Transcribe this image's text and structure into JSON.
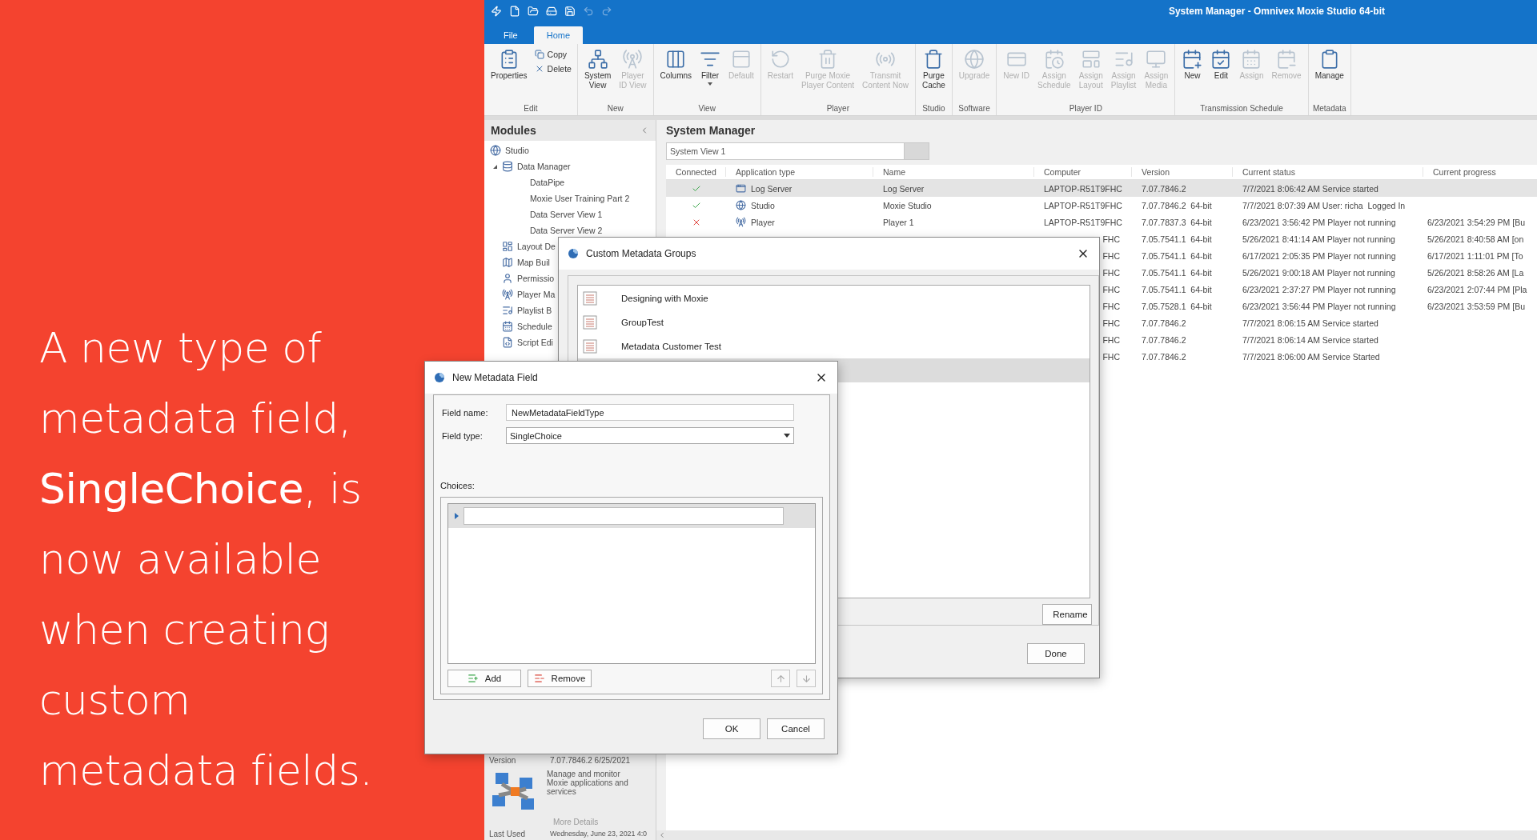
{
  "promo": {
    "text": "A new type of\nmetadata field,\n**SingleChoice**, is\nnow available\nwhen creating\ncustom\nmetadata fields."
  },
  "window": {
    "title": "System Manager - Omnivex Moxie Studio 64-bit"
  },
  "ribbon_tabs": [
    {
      "label": "File",
      "selected": false
    },
    {
      "label": "Home",
      "selected": true
    }
  ],
  "ribbon_groups": [
    {
      "label": "Edit",
      "buttons": [
        {
          "label": "Properties",
          "kind": "large",
          "disabled": false
        },
        {
          "label": "Copy",
          "kind": "small",
          "disabled": false
        },
        {
          "label": "Delete",
          "kind": "small",
          "disabled": false
        }
      ]
    },
    {
      "label": "New",
      "buttons": [
        {
          "label": "System\nView",
          "kind": "large",
          "disabled": false
        },
        {
          "label": "Player\nID View",
          "kind": "large",
          "disabled": true
        }
      ]
    },
    {
      "label": "View",
      "buttons": [
        {
          "label": "Columns",
          "kind": "large",
          "disabled": false
        },
        {
          "label": "Filter",
          "kind": "large",
          "disabled": false,
          "dropdown": true
        },
        {
          "label": "Default",
          "kind": "large",
          "disabled": true
        }
      ]
    },
    {
      "label": "Player",
      "buttons": [
        {
          "label": "Restart",
          "kind": "large",
          "disabled": true
        },
        {
          "label": "Purge Moxie\nPlayer Content",
          "kind": "large",
          "disabled": true
        },
        {
          "label": "Transmit\nContent Now",
          "kind": "large",
          "disabled": true
        }
      ]
    },
    {
      "label": "Studio",
      "buttons": [
        {
          "label": "Purge\nCache",
          "kind": "large",
          "disabled": false
        }
      ]
    },
    {
      "label": "Software",
      "buttons": [
        {
          "label": "Upgrade",
          "kind": "large",
          "disabled": true
        }
      ]
    },
    {
      "label": "Player ID",
      "buttons": [
        {
          "label": "New ID",
          "kind": "large",
          "disabled": true
        },
        {
          "label": "Assign\nSchedule",
          "kind": "large",
          "disabled": true
        },
        {
          "label": "Assign\nLayout",
          "kind": "large",
          "disabled": true
        },
        {
          "label": "Assign\nPlaylist",
          "kind": "large",
          "disabled": true
        },
        {
          "label": "Assign\nMedia",
          "kind": "large",
          "disabled": true
        }
      ]
    },
    {
      "label": "Transmission Schedule",
      "buttons": [
        {
          "label": "New",
          "kind": "large",
          "disabled": false
        },
        {
          "label": "Edit",
          "kind": "large",
          "disabled": false
        },
        {
          "label": "Assign",
          "kind": "large",
          "disabled": true
        },
        {
          "label": "Remove",
          "kind": "large",
          "disabled": true
        }
      ]
    },
    {
      "label": "Metadata",
      "buttons": [
        {
          "label": "Manage",
          "kind": "large",
          "disabled": false
        }
      ]
    }
  ],
  "modules": {
    "title": "Modules",
    "tree": [
      {
        "label": "Studio",
        "children": [
          {
            "label": "Data Manager",
            "expanded": true,
            "children": [
              {
                "label": "DataPipe"
              },
              {
                "label": "Moxie User Training Part 2"
              },
              {
                "label": "Data Server View 1"
              },
              {
                "label": "Data Server View 2"
              }
            ]
          },
          {
            "label": "Layout De"
          },
          {
            "label": "Map Buil"
          },
          {
            "label": "Permissio"
          },
          {
            "label": "Player Ma"
          },
          {
            "label": "Playlist B"
          },
          {
            "label": "Schedule"
          },
          {
            "label": "Script Edi"
          }
        ]
      }
    ],
    "details": {
      "version_label": "Version",
      "version": "7.07.7846.2 6/25/2021",
      "description": "Manage and monitor Moxie applications and services",
      "more_link": "More Details",
      "last_used_label": "Last Used",
      "last_used": "Wednesday, June 23, 2021 4:0"
    }
  },
  "main": {
    "title": "System Manager",
    "view_tabs": [
      {
        "label": "System View 1",
        "selected": true
      }
    ],
    "table": {
      "columns": [
        "Connected",
        "Application type",
        "Name",
        "Computer",
        "Version",
        "Current status",
        "Current progress"
      ],
      "rows": [
        {
          "kind": "full",
          "selected": true,
          "connected": true,
          "app_type": "Log Server",
          "name": "Log Server",
          "computer": "LAPTOP-R51T9FHC",
          "version": "7.07.7846.2",
          "status": "7/7/2021 8:06:42 AM Service started"
        },
        {
          "kind": "full",
          "selected": false,
          "connected": true,
          "app_type": "Studio",
          "name": "Moxie Studio",
          "computer": "LAPTOP-R51T9FHC",
          "version": "7.07.7846.2  64-bit",
          "status": "7/7/2021 8:07:39 AM User: richa  Logged In"
        },
        {
          "kind": "full",
          "selected": false,
          "connected": false,
          "app_type": "Player",
          "name": "Player 1",
          "computer": "LAPTOP-R51T9FHC",
          "version": "7.07.7837.3  64-bit",
          "status": "6/23/2021 3:56:42 PM Player not running",
          "progress": "6/23/2021 3:54:29 PM [Bu"
        },
        {
          "kind": "covered",
          "selected": false,
          "computer": "FHC",
          "version": "7.05.7541.1  64-bit",
          "status": "5/26/2021 8:41:14 AM Player not running",
          "progress": "5/26/2021 8:40:58 AM [on"
        },
        {
          "kind": "covered",
          "selected": false,
          "computer": "FHC",
          "version": "7.05.7541.1  64-bit",
          "status": "6/17/2021 2:05:35 PM Player not running",
          "progress": "6/17/2021 1:11:01 PM [To"
        },
        {
          "kind": "covered",
          "selected": false,
          "computer": "FHC",
          "version": "7.05.7541.1  64-bit",
          "status": "5/26/2021 9:00:18 AM Player not running",
          "progress": "5/26/2021 8:58:26 AM [La"
        },
        {
          "kind": "covered",
          "selected": false,
          "computer": "FHC",
          "version": "7.05.7541.1  64-bit",
          "status": "6/23/2021 2:37:27 PM Player not running",
          "progress": "6/23/2021 2:07:44 PM [Pla"
        },
        {
          "kind": "covered",
          "selected": false,
          "computer": "FHC",
          "version": "7.05.7528.1  64-bit",
          "status": "6/23/2021 3:56:44 PM Player not running",
          "progress": "6/23/2021 3:53:59 PM [Bu"
        },
        {
          "kind": "covered",
          "selected": false,
          "computer": "FHC",
          "version": "7.07.7846.2",
          "status": "7/7/2021 8:06:15 AM Service started"
        },
        {
          "kind": "covered",
          "selected": false,
          "computer": "FHC",
          "version": "7.07.7846.2",
          "status": "7/7/2021 8:06:14 AM Service started"
        },
        {
          "kind": "covered",
          "selected": false,
          "computer": "FHC",
          "version": "7.07.7846.2",
          "status": "7/7/2021 8:06:00 AM Service Started"
        }
      ]
    }
  },
  "groups_dialog": {
    "title": "Custom Metadata Groups",
    "items": [
      {
        "label": "Designing with Moxie",
        "selected": false
      },
      {
        "label": "GroupTest",
        "selected": false
      },
      {
        "label": "Metadata Customer Test",
        "selected": false
      },
      {
        "selected": true
      }
    ],
    "rename": "Rename",
    "done": "Done"
  },
  "field_dialog": {
    "title": "New Metadata Field",
    "name_label": "Field name:",
    "name_value": "NewMetadataFieldType",
    "type_label": "Field type:",
    "type_value": "SingleChoice",
    "choices_label": "Choices:",
    "add": "Add",
    "remove": "Remove",
    "ok": "OK",
    "cancel": "Cancel"
  }
}
